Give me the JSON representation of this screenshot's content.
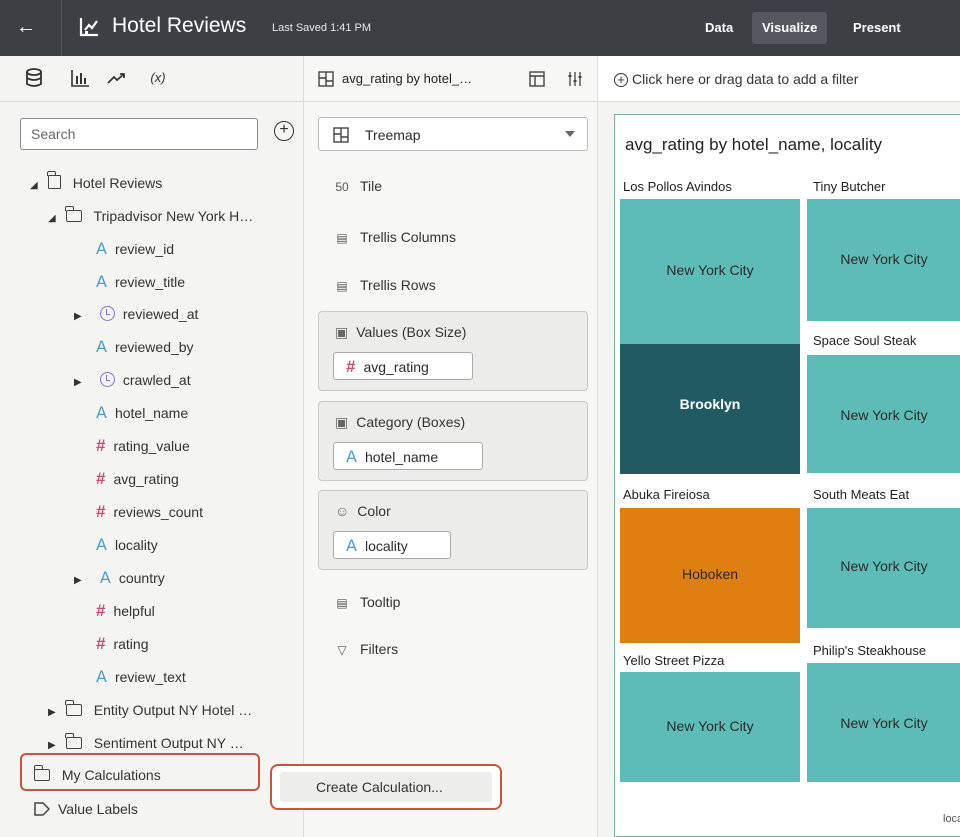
{
  "header": {
    "title": "Hotel Reviews",
    "saved": "Last Saved 1:41 PM",
    "nav": {
      "data": "Data",
      "visualize": "Visualize",
      "present": "Present"
    }
  },
  "data_panel": {
    "search_placeholder": "Search",
    "tree": {
      "root": "Hotel Reviews",
      "folder_main": "Tripadvisor New York H…",
      "fields": [
        {
          "label": "review_id",
          "type": "attribute"
        },
        {
          "label": "review_title",
          "type": "attribute"
        },
        {
          "label": "reviewed_at",
          "type": "time"
        },
        {
          "label": "reviewed_by",
          "type": "attribute"
        },
        {
          "label": "crawled_at",
          "type": "time"
        },
        {
          "label": "hotel_name",
          "type": "attribute"
        },
        {
          "label": "rating_value",
          "type": "measure"
        },
        {
          "label": "avg_rating",
          "type": "measure"
        },
        {
          "label": "reviews_count",
          "type": "measure"
        },
        {
          "label": "locality",
          "type": "attribute"
        },
        {
          "label": "country",
          "type": "attribute"
        },
        {
          "label": "helpful",
          "type": "measure"
        },
        {
          "label": "rating",
          "type": "measure"
        },
        {
          "label": "review_text",
          "type": "attribute"
        }
      ],
      "folder_entity": "Entity Output NY Hotel …",
      "folder_sentiment": "Sentiment Output NY …",
      "my_calculations": "My Calculations",
      "value_labels": "Value Labels"
    }
  },
  "grammar_panel": {
    "header_label": "avg_rating by hotel_…",
    "viz_type": "Treemap",
    "tile": "Tile",
    "tile_icon": "5̅ 0",
    "trellis_columns": "Trellis Columns",
    "trellis_rows": "Trellis Rows",
    "values_title": "Values (Box Size)",
    "values_pill": "avg_rating",
    "category_title": "Category (Boxes)",
    "category_pill": "hotel_name",
    "color_title": "Color",
    "color_pill": "locality",
    "tooltip": "Tooltip",
    "filters": "Filters",
    "create_calc": "Create Calculation..."
  },
  "canvas": {
    "filter_hint": "Click here or drag data to add a filter",
    "viz_title": "avg_rating by hotel_name, locality",
    "legend_label": "locality",
    "tiles": [
      {
        "name": "Los Pollos Avindos",
        "locality": "New York City"
      },
      {
        "name": "",
        "locality": "Brooklyn"
      },
      {
        "name": "Tiny Butcher",
        "locality": "New York City"
      },
      {
        "name": "Space Soul Steak",
        "locality": "New York City"
      },
      {
        "name": "Abuka Fireiosa",
        "locality": "Hoboken"
      },
      {
        "name": "South Meats Eat",
        "locality": "New York City"
      },
      {
        "name": "Yello Street Pizza",
        "locality": "New York City"
      },
      {
        "name": "Philip's Steakhouse",
        "locality": "New York City"
      }
    ],
    "colors": {
      "new_york_city": "#5ebcb8",
      "brooklyn": "#215a63",
      "hoboken": "#df7f12"
    }
  }
}
